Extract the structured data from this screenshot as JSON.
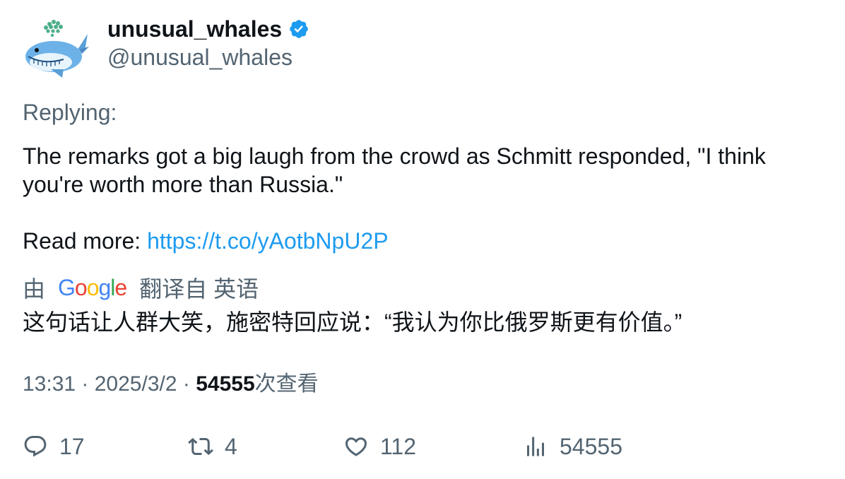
{
  "author": {
    "display_name": "unusual_whales",
    "handle": "@unusual_whales",
    "verified": true,
    "avatar_icon": "whale-icon"
  },
  "tweet": {
    "replying_label": "Replying:",
    "text": "The remarks got a big laugh from the crowd as Schmitt responded, \"I think you're worth more than Russia.\"",
    "read_more_label": "Read more: ",
    "link": "https://t.co/yAotbNpU2P"
  },
  "translation": {
    "prefix": "由",
    "provider": "Google",
    "suffix": "翻译自 英语",
    "text": "这句话让人群大笑，施密特回应说：“我认为你比俄罗斯更有价值。”"
  },
  "meta": {
    "time": "13:31",
    "date": "2025/3/2",
    "views": "54555",
    "views_label": "次查看",
    "separator": " · "
  },
  "actions": {
    "replies": "17",
    "retweets": "4",
    "likes": "112",
    "views": "54555"
  },
  "colors": {
    "text_primary": "#0f1419",
    "text_secondary": "#536471",
    "link": "#1d9bf0",
    "verified": "#1d9bf0"
  }
}
